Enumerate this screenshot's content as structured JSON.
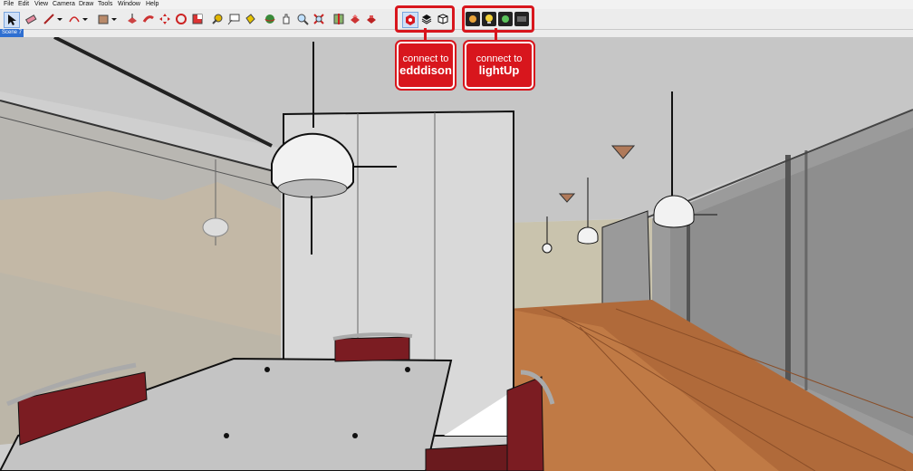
{
  "menu": [
    "File",
    "Edit",
    "View",
    "Camera",
    "Draw",
    "Tools",
    "Window",
    "Help"
  ],
  "scene_tab": "Scene 7",
  "callouts": {
    "edddison": {
      "line1": "connect to",
      "line2": "edddison"
    },
    "lightup": {
      "line1": "connect to",
      "line2": "lightUp"
    }
  },
  "toolbar_icons": [
    "select-arrow-icon",
    "eraser-icon",
    "pencil-icon",
    "dropdown-arrow-icon",
    "arc-icon",
    "dropdown-arrow-icon",
    "rectangle-icon",
    "dropdown-arrow-icon",
    "push-pull-icon",
    "follow-me-icon",
    "move-icon",
    "rotate-icon",
    "scale-icon",
    "tape-measure-icon",
    "text-icon",
    "paint-bucket-icon",
    "orbit-icon",
    "pan-icon",
    "zoom-icon",
    "zoom-extents-icon",
    "section-icon",
    "component-icon",
    "warehouse-icon",
    "edddison-logo-icon",
    "layers-icon",
    "box-icon",
    "lightup-1-icon",
    "lightup-2-icon",
    "lightup-3-icon",
    "lightup-4-icon"
  ],
  "colors": {
    "highlight": "#d8161d",
    "scene_tab": "#2f6fd1",
    "floor": "#b06a3a",
    "wall": "#bdbdbd",
    "chair": "#7b1c22"
  }
}
